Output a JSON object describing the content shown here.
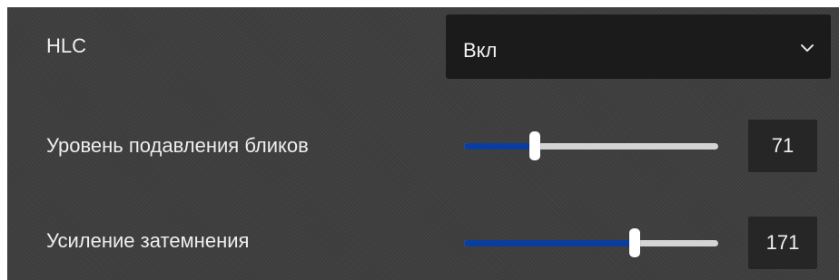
{
  "hlc": {
    "label": "HLC",
    "select_value": "Вкл",
    "dropdown_icon": "chevron-down-icon"
  },
  "glare_suppression": {
    "label": "Уровень подавления бликов",
    "value": "71",
    "slider_fraction": 0.28
  },
  "dark_enhancement": {
    "label": "Усиление затемнения",
    "value": "171",
    "slider_fraction": 0.67
  },
  "colors": {
    "panel_bg": "#3e3e3e",
    "select_bg": "#1b1b1b",
    "slider_fill": "#0a3da0",
    "slider_track": "#d4d4d4",
    "value_box_bg": "#262626"
  }
}
